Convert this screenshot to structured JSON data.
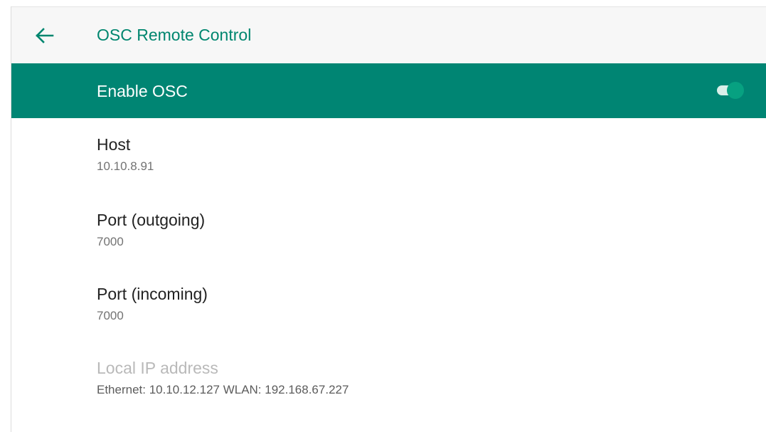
{
  "toolbar": {
    "back_icon": "arrow-back-icon",
    "title": "OSC Remote Control"
  },
  "master_switch": {
    "label": "Enable OSC",
    "checked": true,
    "accent_color": "#008573",
    "thumb_color": "#07a181"
  },
  "preferences": [
    {
      "title": "Host",
      "summary": "10.10.8.91",
      "enabled": true
    },
    {
      "title": "Port (outgoing)",
      "summary": "7000",
      "enabled": true
    },
    {
      "title": "Port (incoming)",
      "summary": "7000",
      "enabled": true
    },
    {
      "title": "Local IP address",
      "summary": "Ethernet: 10.10.12.127 WLAN: 192.168.67.227",
      "enabled": false
    }
  ],
  "colors": {
    "title_accent": "#00866f",
    "toolbar_background": "#f7f7f7"
  }
}
